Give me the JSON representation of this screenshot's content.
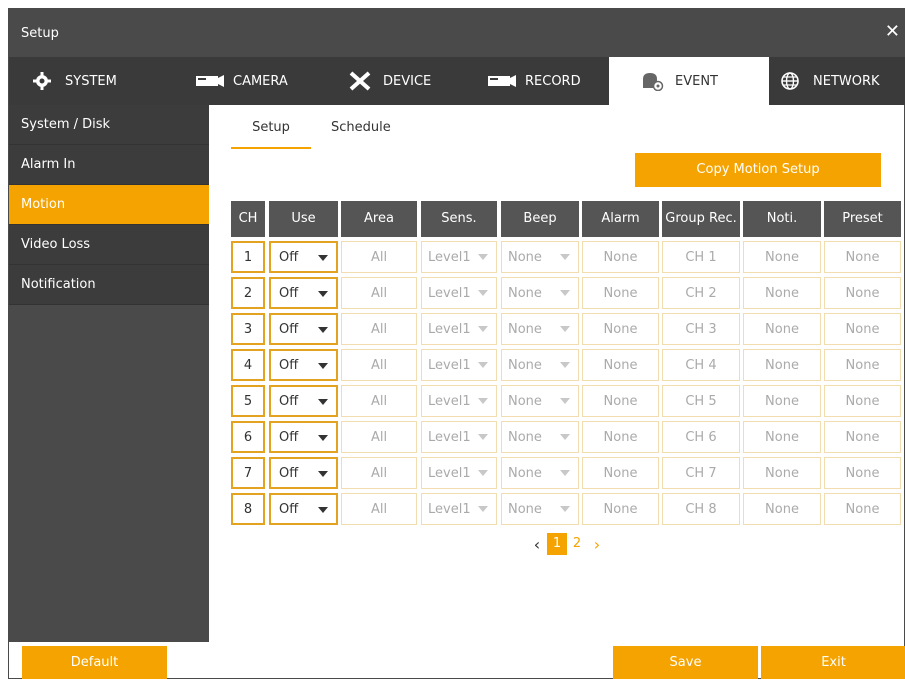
{
  "window": {
    "title": "Setup",
    "close_label": "✕"
  },
  "tabs": [
    {
      "label": "SYSTEM",
      "icon": "gear-icon"
    },
    {
      "label": "CAMERA",
      "icon": "camera-icon"
    },
    {
      "label": "DEVICE",
      "icon": "tools-icon"
    },
    {
      "label": "RECORD",
      "icon": "record-icon"
    },
    {
      "label": "EVENT",
      "icon": "event-icon"
    },
    {
      "label": "NETWORK",
      "icon": "globe-icon"
    }
  ],
  "active_tab": "EVENT",
  "sidebar": {
    "items": [
      "System / Disk",
      "Alarm In",
      "Motion",
      "Video Loss",
      "Notification"
    ],
    "active": "Motion"
  },
  "subtabs": [
    "Setup",
    "Schedule"
  ],
  "copy_button": "Copy Motion Setup",
  "table": {
    "headers": [
      "CH",
      "Use",
      "Area",
      "Sens.",
      "Beep",
      "Alarm",
      "Group Rec.",
      "Noti.",
      "Preset"
    ],
    "rows": [
      {
        "ch": "1",
        "use": "Off",
        "area": "All",
        "sens": "Level1",
        "beep": "None",
        "alarm": "None",
        "group": "CH 1",
        "noti": "None",
        "preset": "None"
      },
      {
        "ch": "2",
        "use": "Off",
        "area": "All",
        "sens": "Level1",
        "beep": "None",
        "alarm": "None",
        "group": "CH 2",
        "noti": "None",
        "preset": "None"
      },
      {
        "ch": "3",
        "use": "Off",
        "area": "All",
        "sens": "Level1",
        "beep": "None",
        "alarm": "None",
        "group": "CH 3",
        "noti": "None",
        "preset": "None"
      },
      {
        "ch": "4",
        "use": "Off",
        "area": "All",
        "sens": "Level1",
        "beep": "None",
        "alarm": "None",
        "group": "CH 4",
        "noti": "None",
        "preset": "None"
      },
      {
        "ch": "5",
        "use": "Off",
        "area": "All",
        "sens": "Level1",
        "beep": "None",
        "alarm": "None",
        "group": "CH 5",
        "noti": "None",
        "preset": "None"
      },
      {
        "ch": "6",
        "use": "Off",
        "area": "All",
        "sens": "Level1",
        "beep": "None",
        "alarm": "None",
        "group": "CH 6",
        "noti": "None",
        "preset": "None"
      },
      {
        "ch": "7",
        "use": "Off",
        "area": "All",
        "sens": "Level1",
        "beep": "None",
        "alarm": "None",
        "group": "CH 7",
        "noti": "None",
        "preset": "None"
      },
      {
        "ch": "8",
        "use": "Off",
        "area": "All",
        "sens": "Level1",
        "beep": "None",
        "alarm": "None",
        "group": "CH 8",
        "noti": "None",
        "preset": "None"
      }
    ]
  },
  "pagination": {
    "prev": "‹",
    "next": "›",
    "pages": [
      "1",
      "2"
    ],
    "current": "1"
  },
  "buttons": {
    "default": "Default",
    "save": "Save",
    "exit": "Exit"
  },
  "colors": {
    "accent": "#f5a300",
    "dark": "#4a4a4a",
    "header": "#555555"
  }
}
